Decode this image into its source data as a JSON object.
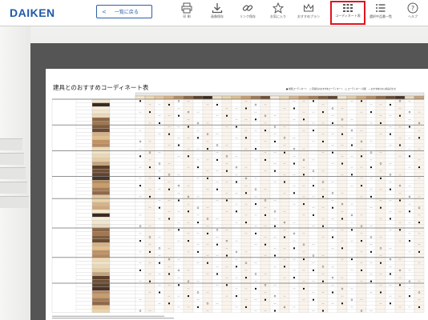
{
  "app": {
    "logo": "DAIKEN",
    "back_label": "一覧に戻る"
  },
  "toolbar": {
    "items": [
      {
        "label": "印 刷",
        "icon": "printer-icon"
      },
      {
        "label": "画像保存",
        "icon": "download-icon"
      },
      {
        "label": "リンク保存",
        "icon": "link-icon"
      },
      {
        "label": "お気に入り",
        "icon": "star-icon"
      },
      {
        "label": "おすすめプラン",
        "icon": "crown-icon"
      },
      {
        "label": "コーディネート表",
        "icon": "grid-table-icon",
        "active": true
      },
      {
        "label": "選択中品番一覧",
        "icon": "list-icon"
      },
      {
        "label": "ヘルプ",
        "icon": "help-icon"
      }
    ]
  },
  "document": {
    "title": "建具とのおすすめコーディネート表",
    "legend": "■ 推奨コーディネート　○ 同系色のおすすめコーディネート　□ コーディネート可能　― おすすめのない組み合わせ",
    "highlight_color": "#e0141e"
  }
}
